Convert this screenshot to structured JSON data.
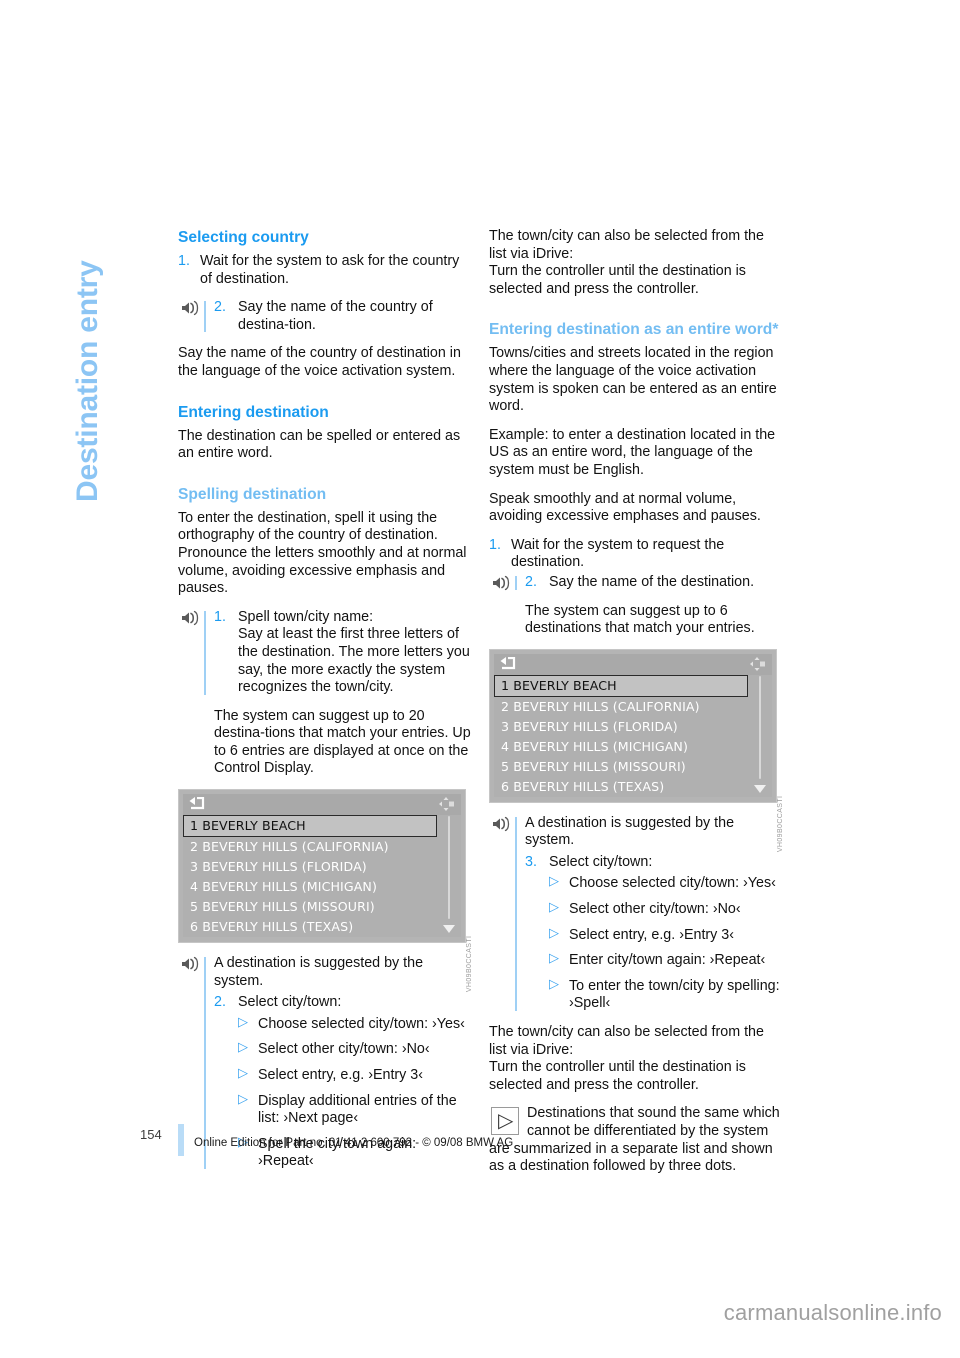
{
  "chapter": {
    "title": "Destination entry"
  },
  "page": {
    "number": "154",
    "footer_text": "Online Edition for Part no. 01 41 2 600 792 - © 09/08 BMW AG",
    "watermark": "carmanualsonline.info"
  },
  "colors": {
    "heading_primary": "#1b9bf0",
    "heading_secondary": "#73bdf2",
    "chapter_title": "#8cc5f4",
    "accent_rule": "#9fd0f5",
    "footer_rule": "#b9dcf7"
  },
  "left_column": {
    "h_selecting_country": "Selecting country",
    "step1_num": "1.",
    "step1_text": "Wait for the system to ask for the country of destination.",
    "step2_num": "2.",
    "step2_text": "Say the name of the country of destina-tion.",
    "para_language": "Say the name of the country of destination in the language of the voice activation system.",
    "h_entering_destination": "Entering destination",
    "para_entering": "The destination can be spelled or entered as an entire word.",
    "h_spelling_destination": "Spelling destination",
    "para_spelling": "To enter the destination, spell it using the orthography of the country of destination. Pronounce the letters smoothly and at normal volume, avoiding excessive emphasis and pauses.",
    "spell_step_num": "1.",
    "spell_step_title": "Spell town/city name:",
    "spell_step_body": "Say at least the first three letters of the destination. The more letters you say, the more exactly the system recognizes the town/city.",
    "para_suggest": "The system can suggest up to 20 destina-tions that match your entries. Up to 6 entries are displayed at once on the Control Display.",
    "note_destination_suggested": "A destination is suggested by the system.",
    "select_step_num": "2.",
    "select_step_title": "Select city/town:",
    "bullets": [
      "Choose selected city/town: ›Yes‹",
      "Select other city/town: ›No‹",
      "Select entry, e.g. ›Entry 3‹",
      "Display additional entries of the list: ›Next page‹",
      "Spell the city/town again: ›Repeat‹"
    ]
  },
  "right_column": {
    "para_idrive_list": "The town/city can also be selected from the list via iDrive:",
    "para_idrive_turn": "Turn the controller until the destination is selected and press the controller.",
    "h_entire_word": "Entering destination as an entire word*",
    "para_entire_word_1": "Towns/cities and streets located in the region where the language of the voice activation system is spoken can be entered as an entire word.",
    "para_entire_word_2": "Example: to enter a destination located in the US as an entire word, the language of the system must be English.",
    "para_entire_word_3": "Speak smoothly and at normal volume, avoiding excessive emphases and pauses.",
    "step1_num": "1.",
    "step1_text": "Wait for the system to request the destination.",
    "step2_num": "2.",
    "step2_text": "Say the name of the destination.",
    "para_suggest_6": "The system can suggest up to 6 destinations that match your entries.",
    "note_destination_suggested": "A destination is suggested by the system.",
    "select_step_num": "3.",
    "select_step_title": "Select city/town:",
    "bullets": [
      "Choose selected city/town: ›Yes‹",
      "Select other city/town: ›No‹",
      "Select entry, e.g. ›Entry 3‹",
      "Enter city/town again: ›Repeat‹",
      "To enter the town/city by spelling: ›Spell‹"
    ],
    "para_idrive_list_2": "The town/city can also be selected from the list via iDrive:",
    "para_idrive_turn_2": "Turn the controller until the destination is selected and press the controller.",
    "note_box_text": "Destinations that sound the same which cannot be differentiated by the system are summarized in a separate list and shown as a destination followed by three dots."
  },
  "nav_screenshot": {
    "watermark": "VH09B0CCASTI",
    "rows": [
      "1 BEVERLY BEACH",
      "2 BEVERLY HILLS (CALIFORNIA)",
      "3 BEVERLY HILLS (FLORIDA)",
      "4 BEVERLY HILLS (MICHIGAN)",
      "5 BEVERLY HILLS (MISSOURI)",
      "6 BEVERLY HILLS (TEXAS)"
    ],
    "selected_index": 0,
    "back_icon": "back-arrow-icon",
    "corner_icon": "controller-cross-icon",
    "scroll_icon": "scroll-down-arrow-icon"
  }
}
